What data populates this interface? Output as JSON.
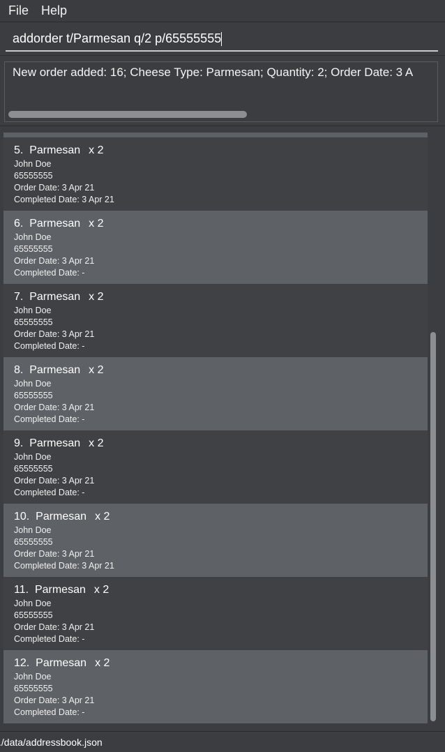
{
  "menu": {
    "file": "File",
    "help": "Help"
  },
  "command": {
    "value": "addorder t/Parmesan q/2 p/65555555"
  },
  "result": {
    "text": "New order added: 16; Cheese Type: Parmesan; Quantity: 2; Order Date: 3 A"
  },
  "orders": [
    {
      "index": "5.",
      "cheese": "Parmesan",
      "qty": "x 2",
      "name": "John Doe",
      "phone": "65555555",
      "order_date": "Order Date: 3 Apr 21",
      "completed_date": "Completed Date: 3 Apr 21"
    },
    {
      "index": "6.",
      "cheese": "Parmesan",
      "qty": "x 2",
      "name": "John Doe",
      "phone": "65555555",
      "order_date": "Order Date: 3 Apr 21",
      "completed_date": "Completed Date: -"
    },
    {
      "index": "7.",
      "cheese": "Parmesan",
      "qty": "x 2",
      "name": "John Doe",
      "phone": "65555555",
      "order_date": "Order Date: 3 Apr 21",
      "completed_date": "Completed Date: -"
    },
    {
      "index": "8.",
      "cheese": "Parmesan",
      "qty": "x 2",
      "name": "John Doe",
      "phone": "65555555",
      "order_date": "Order Date: 3 Apr 21",
      "completed_date": "Completed Date: -"
    },
    {
      "index": "9.",
      "cheese": "Parmesan",
      "qty": "x 2",
      "name": "John Doe",
      "phone": "65555555",
      "order_date": "Order Date: 3 Apr 21",
      "completed_date": "Completed Date: -"
    },
    {
      "index": "10.",
      "cheese": "Parmesan",
      "qty": "x 2",
      "name": "John Doe",
      "phone": "65555555",
      "order_date": "Order Date: 3 Apr 21",
      "completed_date": "Completed Date: 3 Apr 21"
    },
    {
      "index": "11.",
      "cheese": "Parmesan",
      "qty": "x 2",
      "name": "John Doe",
      "phone": "65555555",
      "order_date": "Order Date: 3 Apr 21",
      "completed_date": "Completed Date: -"
    },
    {
      "index": "12.",
      "cheese": "Parmesan",
      "qty": "x 2",
      "name": "John Doe",
      "phone": "65555555",
      "order_date": "Order Date: 3 Apr 21",
      "completed_date": "Completed Date: -"
    }
  ],
  "status": {
    "path": "./data/addressbook.json"
  },
  "colors": {
    "background": "#3b3d40",
    "card_dark": "#3f4144",
    "card_light": "#5e6165",
    "scroll_thumb": "#8c8e91"
  }
}
